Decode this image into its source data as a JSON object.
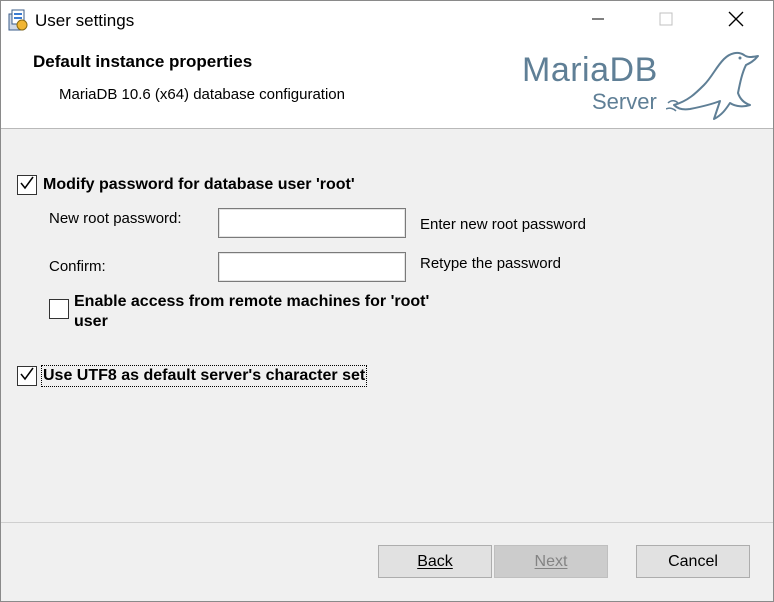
{
  "window": {
    "title": "User settings",
    "controls": [
      "minimize-icon",
      "maximize-icon",
      "close-icon"
    ]
  },
  "banner": {
    "title": "Default instance properties",
    "subtitle": "MariaDB 10.6 (x64) database configuration",
    "logo_main": "MariaDB",
    "logo_sub": "Server"
  },
  "form": {
    "modify_password": {
      "label": "Modify password for database user 'root'",
      "checked": true
    },
    "new_password": {
      "label": "New root password:",
      "value": "",
      "hint": "Enter new root password"
    },
    "confirm": {
      "label": "Confirm:",
      "value": "",
      "hint": "Retype the password"
    },
    "remote_access": {
      "label_line1": "Enable access from remote machines for 'root'",
      "label_line2": "user",
      "checked": false
    },
    "utf8": {
      "label": "Use UTF8 as default server's character set",
      "checked": true
    }
  },
  "buttons": {
    "back": "Back",
    "next": "Next",
    "cancel": "Cancel"
  },
  "colors": {
    "logo": "#5f7f96",
    "disabled_text": "#838383"
  }
}
